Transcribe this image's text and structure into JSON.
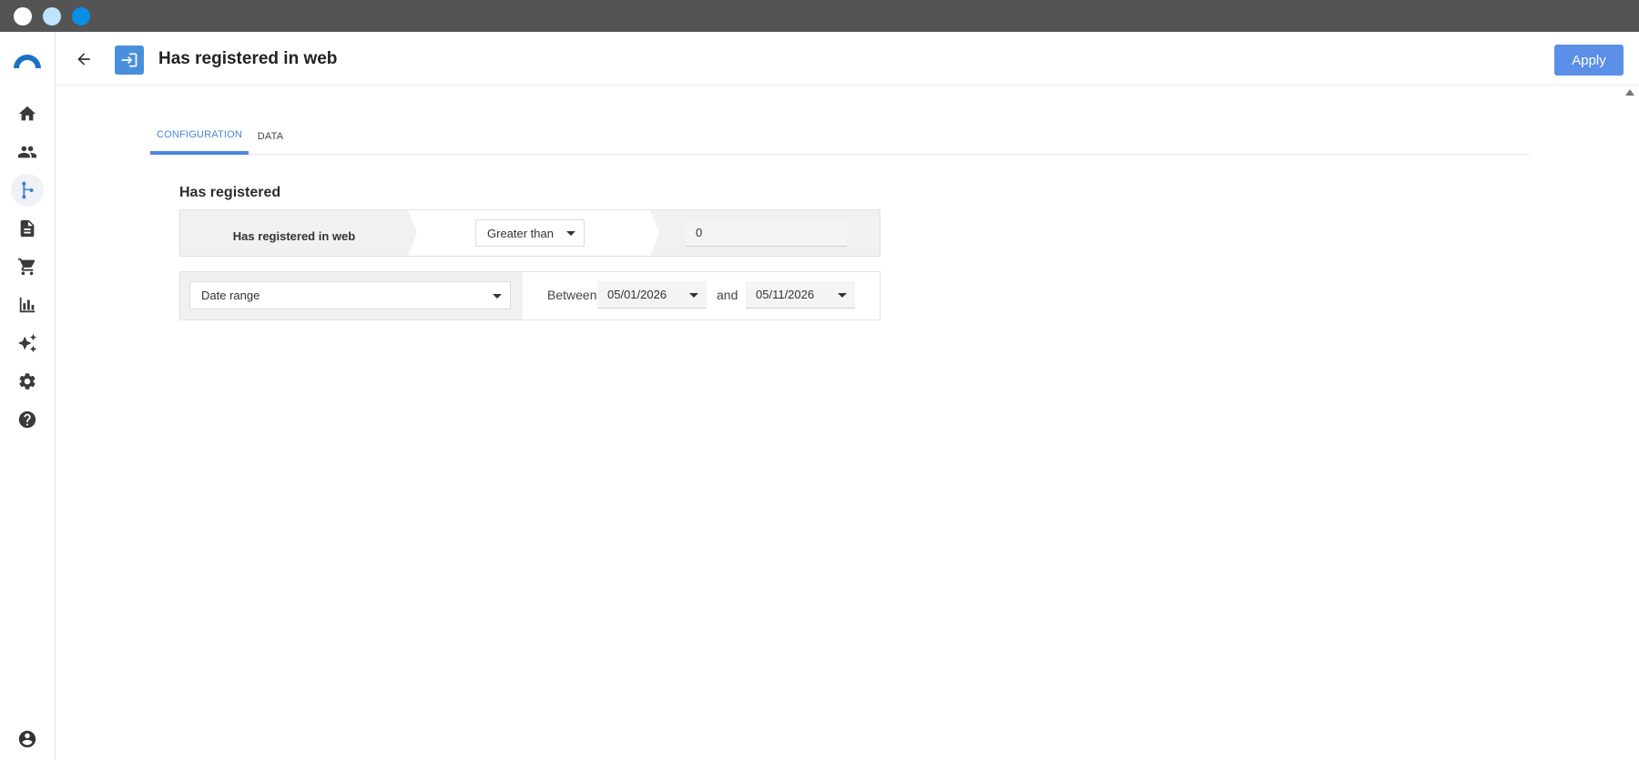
{
  "window": {
    "controls": [
      "close",
      "minimize",
      "maximize"
    ]
  },
  "sidebar": {
    "items": [
      {
        "icon": "home-icon",
        "active": false
      },
      {
        "icon": "people-icon",
        "active": false
      },
      {
        "icon": "journey-icon",
        "active": true
      },
      {
        "icon": "document-icon",
        "active": false
      },
      {
        "icon": "cart-icon",
        "active": false
      },
      {
        "icon": "bar-chart-icon",
        "active": false
      },
      {
        "icon": "sparkle-icon",
        "active": false
      },
      {
        "icon": "gear-icon",
        "active": false
      },
      {
        "icon": "help-icon",
        "active": false
      }
    ],
    "bottom_icon": "account-icon"
  },
  "header": {
    "title": "Has registered in web",
    "icon": "login-icon",
    "apply_label": "Apply"
  },
  "tabs": [
    {
      "label": "CONFIGURATION",
      "active": true
    },
    {
      "label": "DATA",
      "active": false
    }
  ],
  "section": {
    "title": "Has registered",
    "condition": {
      "name": "Has registered in web",
      "operator": "Greater than",
      "value": "0"
    },
    "date_filter": {
      "range_type": "Date range",
      "between_label": "Between",
      "from": "05/01/2026",
      "and_label": "and",
      "to": "05/11/2026"
    }
  },
  "colors": {
    "accent": "#4a86db",
    "apply_button": "#5b8fe8",
    "titlebar": "#545454"
  }
}
